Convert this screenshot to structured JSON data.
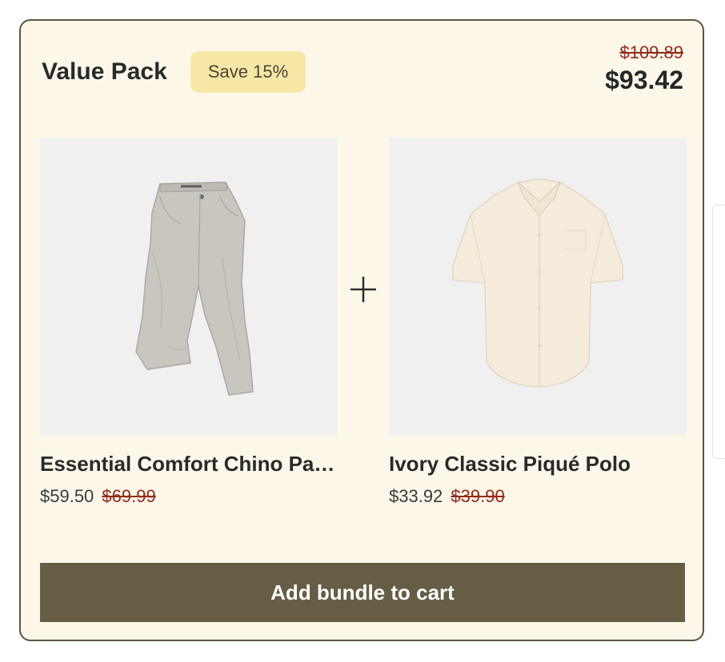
{
  "bundle": {
    "title": "Value Pack",
    "badge": "Save 15%",
    "original_total": "$109.89",
    "total": "$93.42",
    "add_button_label": "Add bundle to cart"
  },
  "products": [
    {
      "name": "Essential Comfort Chino Pants",
      "price": "$59.50",
      "original_price": "$69.99",
      "icon": "chino-pants-image"
    },
    {
      "name": "Ivory Classic Piqué Polo",
      "price": "$33.92",
      "original_price": "$39.90",
      "icon": "polo-shirt-image"
    }
  ],
  "colors": {
    "card_background": "#fdf7ea",
    "card_border": "#5c5540",
    "badge_background": "#f6e7a6",
    "strikethrough_price": "#8f2b1c",
    "button_background": "#665d45",
    "button_text": "#ffffff"
  }
}
